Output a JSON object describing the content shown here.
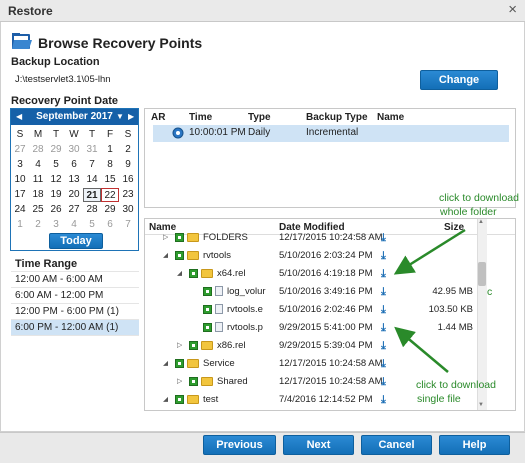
{
  "window": {
    "title": "Restore",
    "close": "×"
  },
  "header": {
    "title": "Browse Recovery Points"
  },
  "backup_location": {
    "label": "Backup Location",
    "path": "J:\\testservlet3.1\\05-lhn",
    "change_label": "Change"
  },
  "recovery_point_date": {
    "label": "Recovery Point Date"
  },
  "calendar": {
    "month": "September 2017",
    "dow": [
      "S",
      "M",
      "T",
      "W",
      "T",
      "F",
      "S"
    ],
    "weeks": [
      [
        "27",
        "28",
        "29",
        "30",
        "31",
        "1",
        "2"
      ],
      [
        "3",
        "4",
        "5",
        "6",
        "7",
        "8",
        "9"
      ],
      [
        "10",
        "11",
        "12",
        "13",
        "14",
        "15",
        "16"
      ],
      [
        "17",
        "18",
        "19",
        "20",
        "21",
        "22",
        "23"
      ],
      [
        "24",
        "25",
        "26",
        "27",
        "28",
        "29",
        "30"
      ],
      [
        "1",
        "2",
        "3",
        "4",
        "5",
        "6",
        "7"
      ]
    ],
    "today_label": "Today"
  },
  "time_range": {
    "label": "Time Range",
    "items": [
      "12:00 AM - 6:00 AM",
      "6:00 AM - 12:00 PM",
      "12:00 PM - 6:00 PM    (1)",
      "6:00 PM - 12:00 AM    (1)"
    ]
  },
  "recovery_points": {
    "headers": [
      "AR",
      "Time",
      "Type",
      "Backup Type",
      "Name"
    ],
    "rows": [
      {
        "time": "10:00:01 PM",
        "type": "Daily",
        "backup_type": "Incremental",
        "name": ""
      }
    ]
  },
  "files": {
    "headers": [
      "Name",
      "Date Modified",
      "Size"
    ],
    "rows": [
      {
        "name": "FOLDERS",
        "date": "12/17/2015 10:24:58 AM",
        "size": ""
      },
      {
        "name": "rvtools",
        "date": "5/10/2016 2:03:24 PM",
        "size": ""
      },
      {
        "name": "x64.rel",
        "date": "5/10/2016 4:19:18 PM",
        "size": ""
      },
      {
        "name": "log_volur",
        "date": "5/10/2016 3:49:16 PM",
        "size": "42.95 MB"
      },
      {
        "name": "rvtools.e",
        "date": "5/10/2016 2:02:46 PM",
        "size": "103.50 KB"
      },
      {
        "name": "rvtools.p",
        "date": "9/29/2015 5:41:00 PM",
        "size": "1.44 MB"
      },
      {
        "name": "x86.rel",
        "date": "9/29/2015 5:39:04 PM",
        "size": ""
      },
      {
        "name": "Service",
        "date": "12/17/2015 10:24:58 AM",
        "size": ""
      },
      {
        "name": "Shared",
        "date": "12/17/2015 10:24:58 AM",
        "size": ""
      },
      {
        "name": "test",
        "date": "7/4/2016 12:14:52 PM",
        "size": ""
      }
    ]
  },
  "annotations": {
    "folder_line1": "click to download",
    "folder_line2": "whole folder",
    "file_line1": "click to download",
    "file_line2": "single file",
    "stray": "c"
  },
  "footer": {
    "previous": "Previous",
    "next": "Next",
    "cancel": "Cancel",
    "help": "Help"
  },
  "colors": {
    "accent": "#1a76bd",
    "selection": "#cfe3f5",
    "annotation": "#2a8a2a"
  }
}
